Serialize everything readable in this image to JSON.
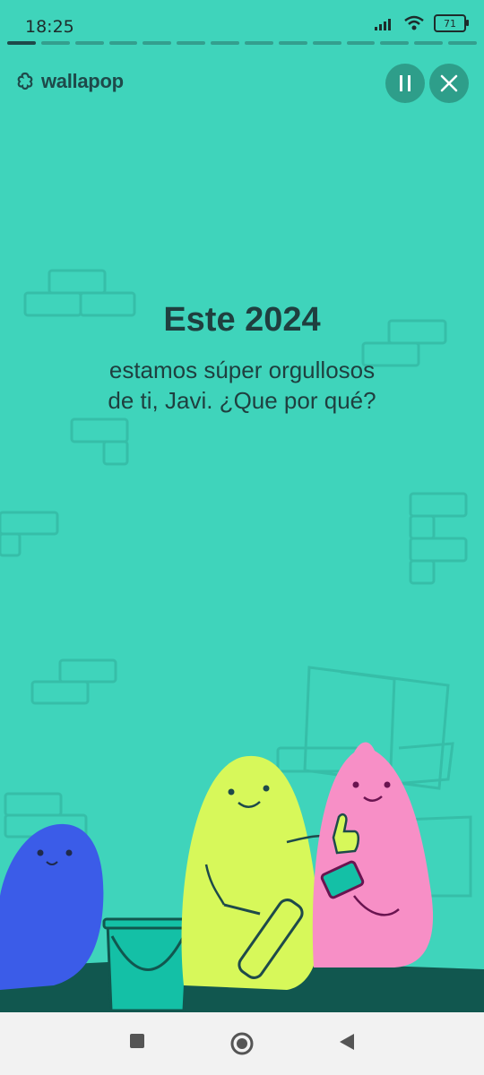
{
  "status_bar": {
    "time": "18:25",
    "battery": "71"
  },
  "story": {
    "segments_total": 14,
    "segments_done": 1
  },
  "header": {
    "logo_text": "wallapop"
  },
  "content": {
    "title": "Este 2024",
    "subtitle_line1": "estamos súper orgullosos",
    "subtitle_line2": "de ti, Javi. ¿Que por qué?"
  },
  "colors": {
    "background": "#3fd4bb",
    "ground": "#11574f",
    "blue_char": "#3b5ce8",
    "lime_char": "#d7f85a",
    "pink_char": "#f78fc6"
  },
  "icons": {
    "pause": "pause-icon",
    "close": "close-icon",
    "nav_recents": "square-icon",
    "nav_home": "circle-icon",
    "nav_back": "triangle-back-icon"
  }
}
